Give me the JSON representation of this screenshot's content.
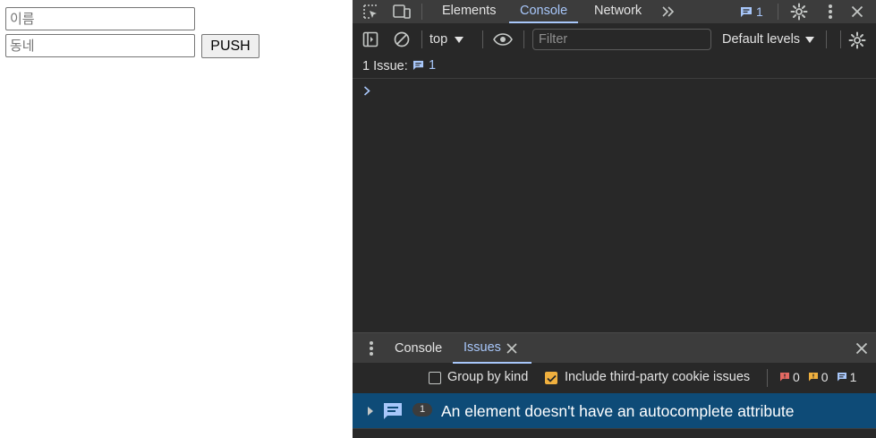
{
  "page": {
    "name_field": {
      "placeholder": "이름",
      "value": ""
    },
    "town_field": {
      "placeholder": "동네",
      "value": ""
    },
    "push_label": "PUSH"
  },
  "devtools": {
    "tabs": [
      {
        "label": "Elements",
        "active": false
      },
      {
        "label": "Console",
        "active": true
      },
      {
        "label": "Network",
        "active": false
      }
    ],
    "more_tabs_icon": "chevron-double-right-icon",
    "issues_badge_count": "1",
    "toolbar": {
      "context_label": "top",
      "filter_placeholder": "Filter",
      "levels_label": "Default levels"
    },
    "issue_bar": {
      "label": "1 Issue:",
      "count": "1"
    },
    "drawer": {
      "tabs": [
        {
          "label": "Console",
          "active": false
        },
        {
          "label": "Issues",
          "active": true
        }
      ],
      "group_by_kind": {
        "label": "Group by kind",
        "checked": false
      },
      "third_party": {
        "label": "Include third-party cookie issues",
        "checked": true
      },
      "counts": {
        "errors": "0",
        "warnings": "0",
        "info": "1"
      },
      "issue": {
        "count": "1",
        "title": "An element doesn't have an autocomplete attribute"
      }
    }
  },
  "colors": {
    "accent": "#a8c7fa",
    "panel_bg": "#282828",
    "bar_bg": "#3c3c3c",
    "selected_row": "#0e4b77",
    "checkbox_checked": "#f0b03e",
    "error_badge": "#e46962",
    "warning_badge": "#f0b03e",
    "info_badge": "#a8c7fa"
  }
}
